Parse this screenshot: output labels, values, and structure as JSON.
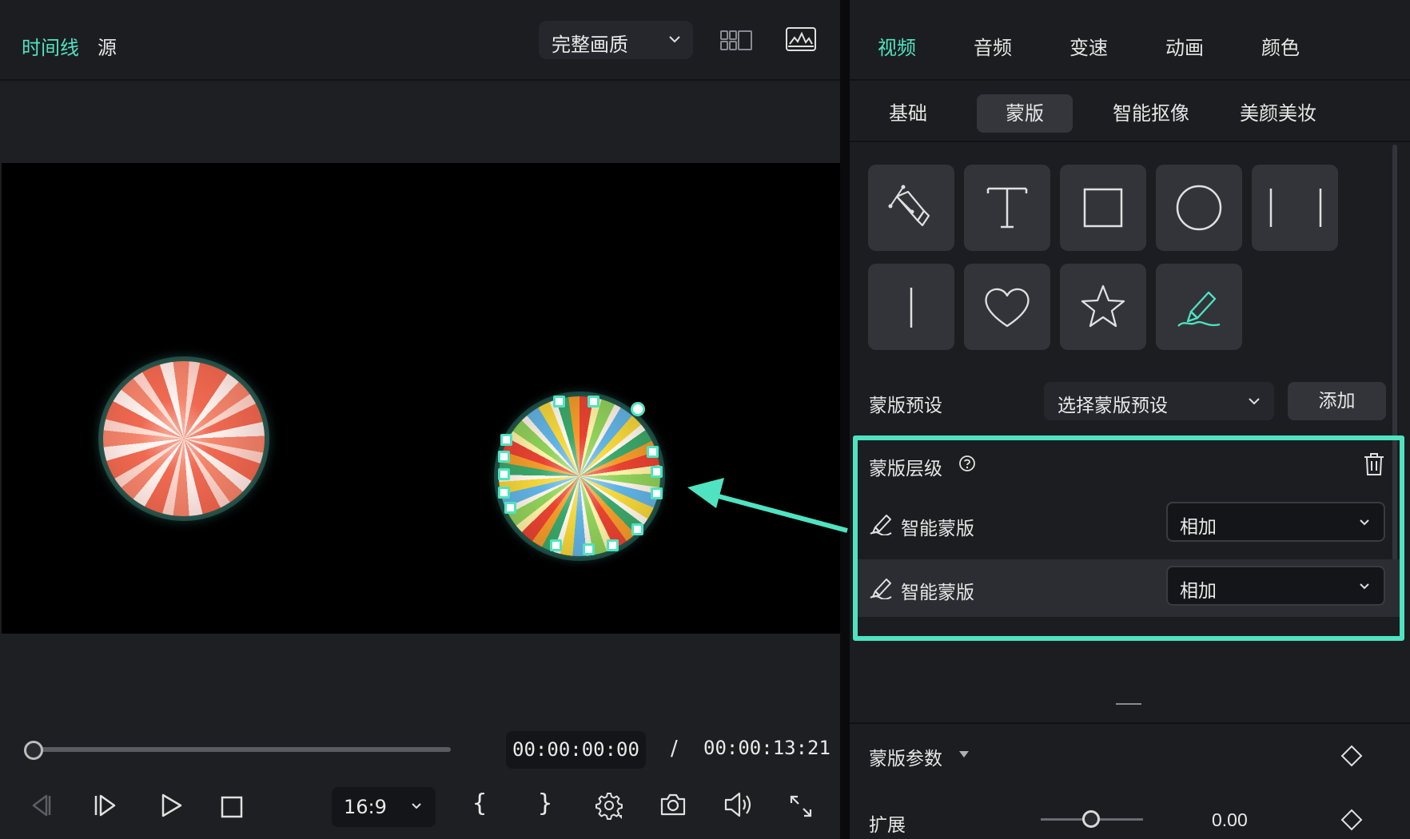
{
  "player": {
    "tabs": [
      {
        "label": "时间线",
        "active": true
      },
      {
        "label": "源",
        "active": false
      }
    ],
    "quality_select": {
      "value": "完整画质"
    },
    "header_icons": [
      "grid-layout-icon",
      "waveform-monitor-icon"
    ],
    "playback": {
      "current_time": "00:00:00:00",
      "separator": "/",
      "total_time": "00:00:13:21",
      "progress": 0
    },
    "controls": {
      "aspect_ratio": "16:9",
      "mark_in": "{",
      "mark_out": "}",
      "icons": [
        "prev-frame-icon",
        "next-frame-icon",
        "play-icon",
        "stop-icon",
        "settings-icon",
        "snapshot-icon",
        "volume-icon",
        "fullscreen-icon"
      ]
    }
  },
  "panel": {
    "main_tabs": [
      {
        "label": "视频",
        "active": true
      },
      {
        "label": "音频",
        "active": false
      },
      {
        "label": "变速",
        "active": false
      },
      {
        "label": "动画",
        "active": false
      },
      {
        "label": "颜色",
        "active": false
      }
    ],
    "sub_tabs": [
      {
        "label": "基础",
        "active": false
      },
      {
        "label": "蒙版",
        "active": true
      },
      {
        "label": "智能抠像",
        "active": false
      },
      {
        "label": "美颜美妆",
        "active": false
      }
    ],
    "mask_shapes": [
      "pen-icon",
      "text-icon",
      "rectangle-icon",
      "circle-icon",
      "double-line-icon",
      "single-line-icon",
      "heart-icon",
      "star-icon",
      "smart-brush-icon"
    ],
    "mask_preset": {
      "label": "蒙版预设",
      "placeholder": "选择蒙版预设",
      "add_label": "添加"
    },
    "mask_layers": {
      "title": "蒙版层级",
      "items": [
        {
          "name": "智能蒙版",
          "blend": "相加",
          "selected": false
        },
        {
          "name": "智能蒙版",
          "blend": "相加",
          "selected": true
        }
      ]
    },
    "mask_params": {
      "title": "蒙版参数",
      "expand_label": "扩展",
      "expand_value": "0.00"
    }
  },
  "colors": {
    "accent": "#4fe3c1",
    "panel_bg": "#1c1d21",
    "button_bg": "#33343a"
  }
}
